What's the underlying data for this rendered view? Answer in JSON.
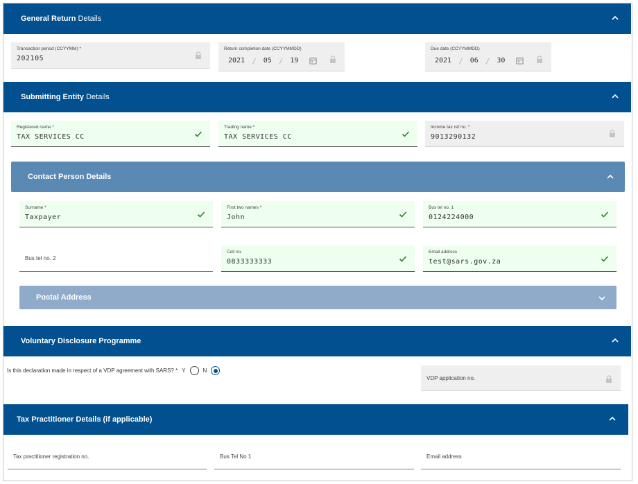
{
  "general_return": {
    "title_bold": "General Return",
    "title_rest": " Details",
    "transaction_period": {
      "label": "Transaction period (CCYYMM) *",
      "value": "202105"
    },
    "return_completion_date": {
      "label": "Return completion date (CCYYMMDD)",
      "year": "2021",
      "month": "05",
      "day": "19"
    },
    "due_date": {
      "label": "Due date (CCYYMMDD)",
      "year": "2021",
      "month": "06",
      "day": "30"
    }
  },
  "submitting_entity": {
    "title_bold": "Submitting Entity",
    "title_rest": " Details",
    "registered_name": {
      "label": "Registered name *",
      "value": "TAX SERVICES CC"
    },
    "trading_name": {
      "label": "Trading name *",
      "value": "TAX SERVICES CC"
    },
    "income_tax_ref": {
      "label": "Income tax ref no. *",
      "value": "9013290132"
    }
  },
  "contact_person": {
    "title": "Contact Person Details",
    "surname": {
      "label": "Surname *",
      "value": "Taxpayer"
    },
    "first_two_names": {
      "label": "First two names *",
      "value": "John"
    },
    "bus_tel_1": {
      "label": "Bus tel no. 1",
      "value": "0124224000"
    },
    "bus_tel_2": {
      "placeholder": "Bus tel no. 2"
    },
    "cell_no": {
      "label": "Cell no.",
      "value": "0833333333"
    },
    "email": {
      "label": "Email address",
      "value": "test@sars.gov.za"
    }
  },
  "postal_address": {
    "title": "Postal Address"
  },
  "vdp": {
    "title": "Voluntary Disclosure Programme",
    "question": "Is this declaration made in respect of a VDP agreement with SARS? *",
    "option_y": "Y",
    "option_n": "N",
    "selected": "N",
    "application_no": {
      "placeholder": "VDP application no."
    }
  },
  "tax_practitioner": {
    "title": "Tax Practitioner Details (if applicable)",
    "registration_no": {
      "placeholder": "Tax practitioner registration no."
    },
    "bus_tel": {
      "placeholder": "Bus Tel No 1"
    },
    "email": {
      "placeholder": "Email address"
    }
  },
  "colors": {
    "section_bar": "#02508f",
    "sub_bar": "#5a89b4",
    "sub_bar_collapsed": "#8fabc9",
    "valid_bg": "#eefeef",
    "locked_bg": "#efefef",
    "check": "#2e7d32"
  },
  "icons": [
    "chevron-up-icon",
    "chevron-down-icon",
    "lock-icon",
    "calendar-icon",
    "check-icon"
  ]
}
